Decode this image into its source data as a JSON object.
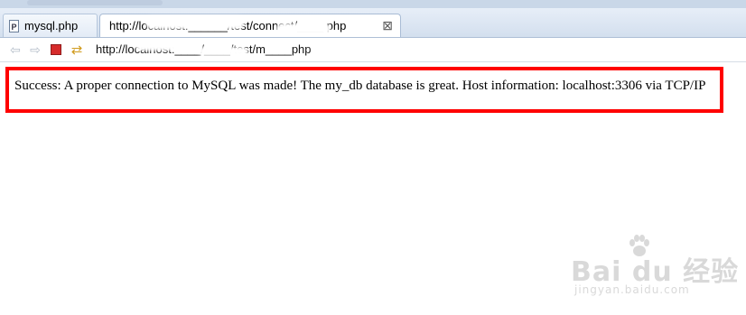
{
  "tabs": [
    {
      "label": "mysql.php",
      "file_badge": "P"
    },
    {
      "label": "http://localhost:______/test/connect/____.php",
      "close_glyph": "⊠"
    }
  ],
  "navigation": {
    "back_glyph": "⇦",
    "forward_glyph": "⇨",
    "refresh_glyph": "⇄",
    "url": "http://localhost:____/____/test/m____php"
  },
  "page": {
    "message": "Success: A proper connection to MySQL was made! The my_db database is great. Host information: localhost:3306 via TCP/IP"
  },
  "watermark": {
    "main": "Bai du 经验",
    "sub": "jingyan.baidu.com"
  },
  "colors": {
    "highlight_border": "#ff0000",
    "tabbar_background": "#d3dfee",
    "stop_icon": "#d62b2b"
  }
}
